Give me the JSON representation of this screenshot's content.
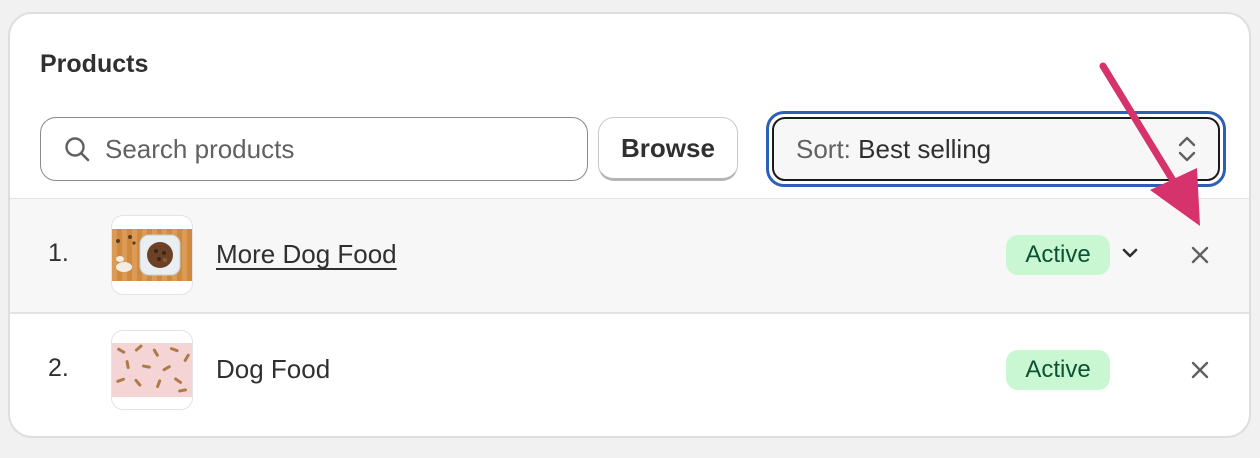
{
  "card": {
    "title": "Products"
  },
  "search": {
    "placeholder": "Search products",
    "value": ""
  },
  "browse": {
    "label": "Browse"
  },
  "sort": {
    "prefix": "Sort:",
    "value": "Best selling"
  },
  "products": [
    {
      "index": "1.",
      "name": "More Dog Food",
      "status": "Active",
      "thumbnail": "dog-food-bowl-image"
    },
    {
      "index": "2.",
      "name": "Dog Food",
      "status": "Active",
      "thumbnail": "bone-treats-pattern-image"
    }
  ],
  "colors": {
    "badge_bg": "#c9f7d2",
    "badge_text": "#0c5132",
    "focus_ring": "#2c5fb6",
    "annotation_arrow": "#d6336c"
  },
  "icons": [
    "search-icon",
    "select-arrows-icon",
    "chevron-down-icon",
    "close-icon",
    "arrow-annotation-icon"
  ]
}
